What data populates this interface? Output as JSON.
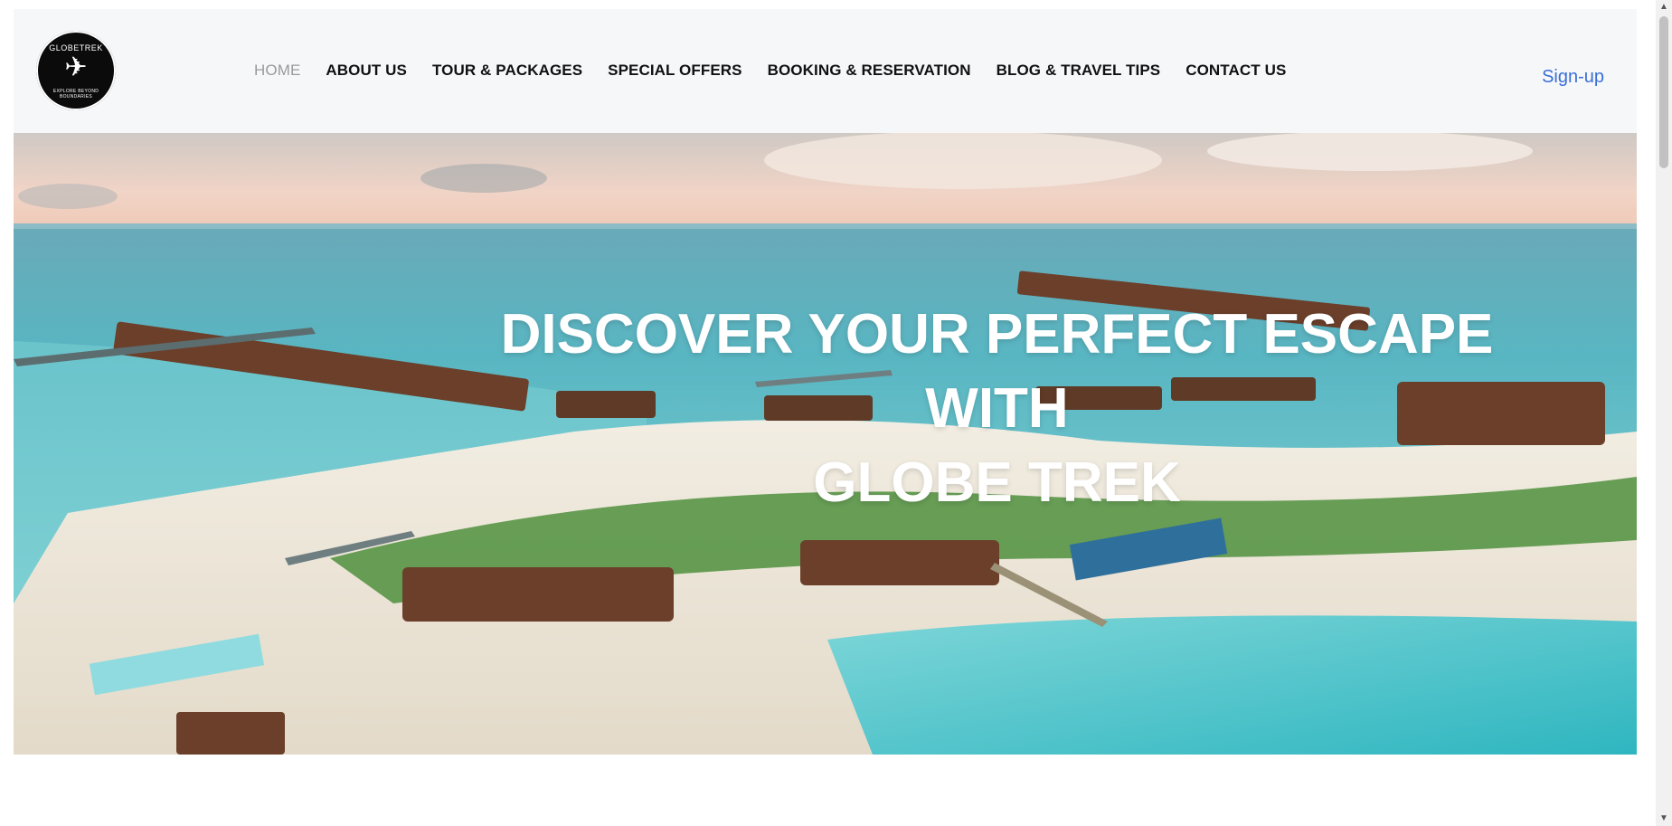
{
  "brand": {
    "logo_title": "GLOBETREK",
    "logo_tagline": "EXPLORE BEYOND BOUNDARIES",
    "plane_glyph": "✈"
  },
  "nav": {
    "items": [
      {
        "label": "HOME",
        "active": true
      },
      {
        "label": "ABOUT US"
      },
      {
        "label": "TOUR & PACKAGES"
      },
      {
        "label": "SPECIAL OFFERS"
      },
      {
        "label": "BOOKING & RESERVATION"
      },
      {
        "label": "BLOG & TRAVEL TIPS"
      },
      {
        "label": "CONTACT US"
      }
    ],
    "signup_label": "Sign-up"
  },
  "hero": {
    "title_line1": "DISCOVER YOUR PERFECT ESCAPE WITH",
    "title_line2": "GLOBE TREK"
  },
  "colors": {
    "navbar_bg": "#f6f7f9",
    "signup": "#3a6fd8",
    "active_nav": "#9a9a9a",
    "sea": "#3fb6c4",
    "sand": "#ece6d8"
  },
  "scrollbar": {
    "up_icon": "▲",
    "down_icon": "▼"
  }
}
